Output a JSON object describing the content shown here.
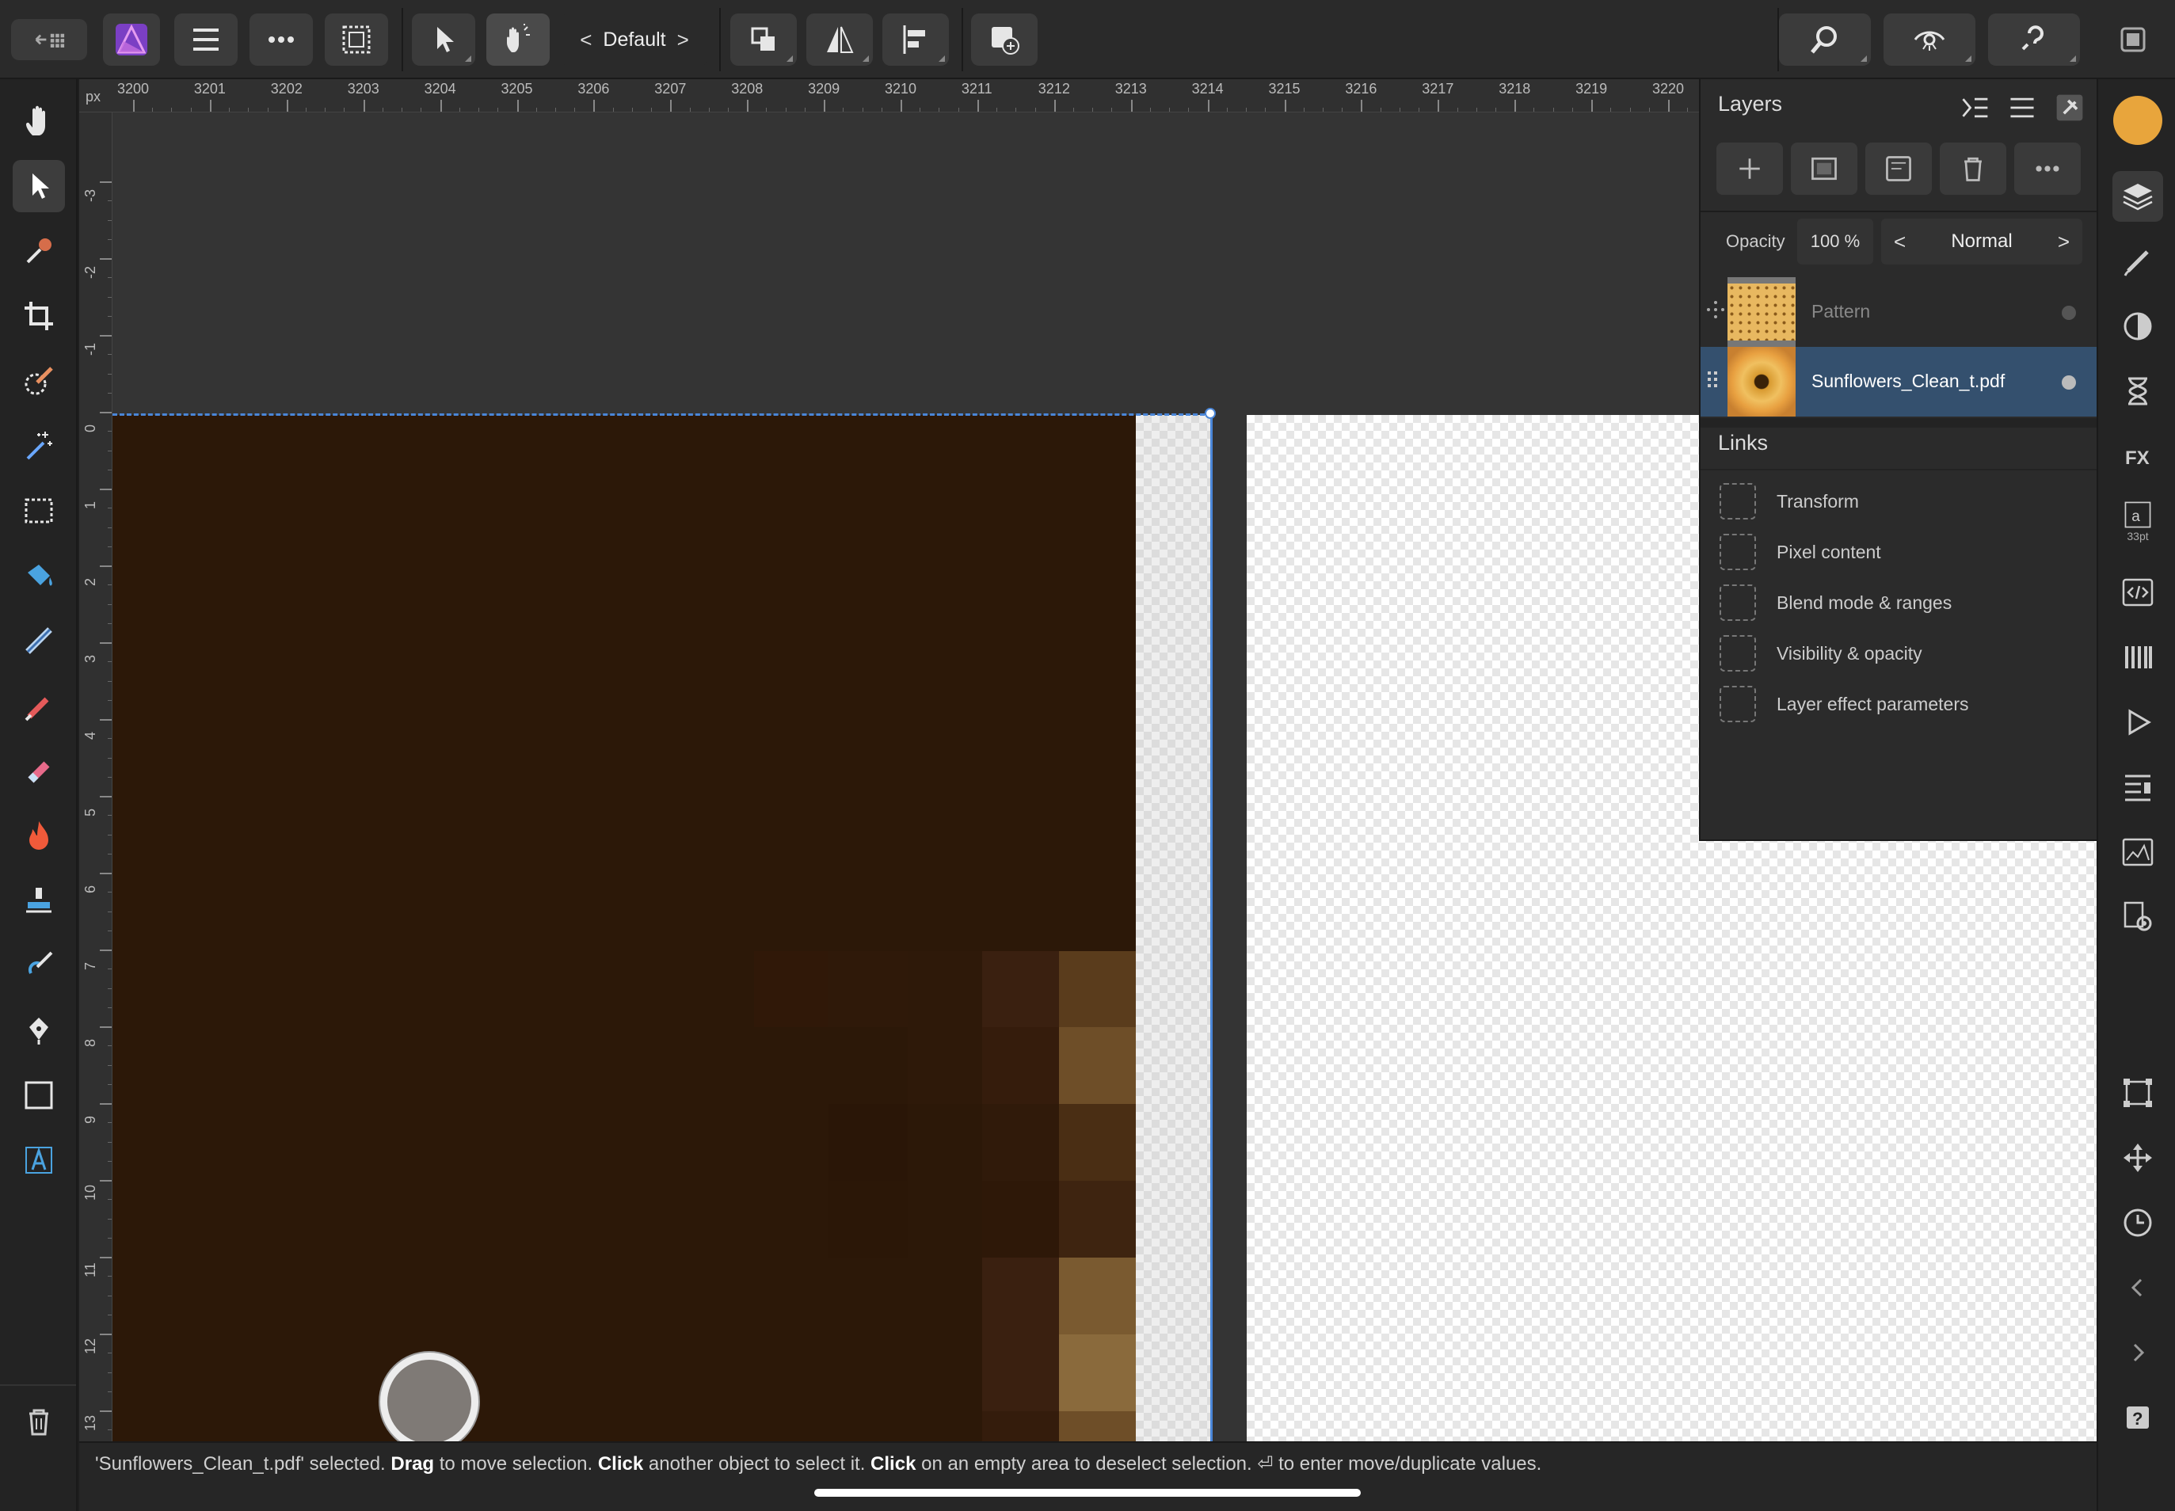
{
  "toolbar": {
    "back_icon": "back-grid-icon",
    "persona_selector": "Default",
    "persona_prev": "<",
    "persona_next": ">"
  },
  "rulers": {
    "unit": "px",
    "horizontal": [
      "3200",
      "3201",
      "3202",
      "3203",
      "3204",
      "3205",
      "3206",
      "3207",
      "3208",
      "3209",
      "3210",
      "3211",
      "3212",
      "3213",
      "3214",
      "3215",
      "3216",
      "3217",
      "3218",
      "3219",
      "3220"
    ],
    "vertical": [
      "-3",
      "-2",
      "-1",
      "0",
      "1",
      "2",
      "3",
      "4",
      "5",
      "6",
      "7",
      "8",
      "9",
      "10",
      "11",
      "12",
      "13"
    ]
  },
  "layers_panel": {
    "title": "Layers",
    "opacity_label": "Opacity",
    "opacity_value": "100 %",
    "blend_mode": "Normal",
    "blend_prev": "<",
    "blend_next": ">",
    "layers": [
      {
        "name": "Pattern",
        "selected": false
      },
      {
        "name": "Sunflowers_Clean_t.pdf",
        "selected": true
      }
    ],
    "links_title": "Links",
    "links": [
      "Transform",
      "Pixel content",
      "Blend mode & ranges",
      "Visibility & opacity",
      "Layer effect parameters"
    ]
  },
  "right_bar": {
    "text_size_label": "33pt",
    "color_swatch": "#e8a53c"
  },
  "status": {
    "part1": "'Sunflowers_Clean_t.pdf' selected. ",
    "drag": "Drag",
    "part2": " to move selection. ",
    "click1": "Click",
    "part3": " another object to select it. ",
    "click2": "Click",
    "part4": " on an empty area to deselect selection. ⏎ to enter move/duplicate values."
  },
  "colors": {
    "accent": "#4a86d8",
    "selected_layer": "#34506e",
    "canvas_brown": "#2c1808"
  }
}
